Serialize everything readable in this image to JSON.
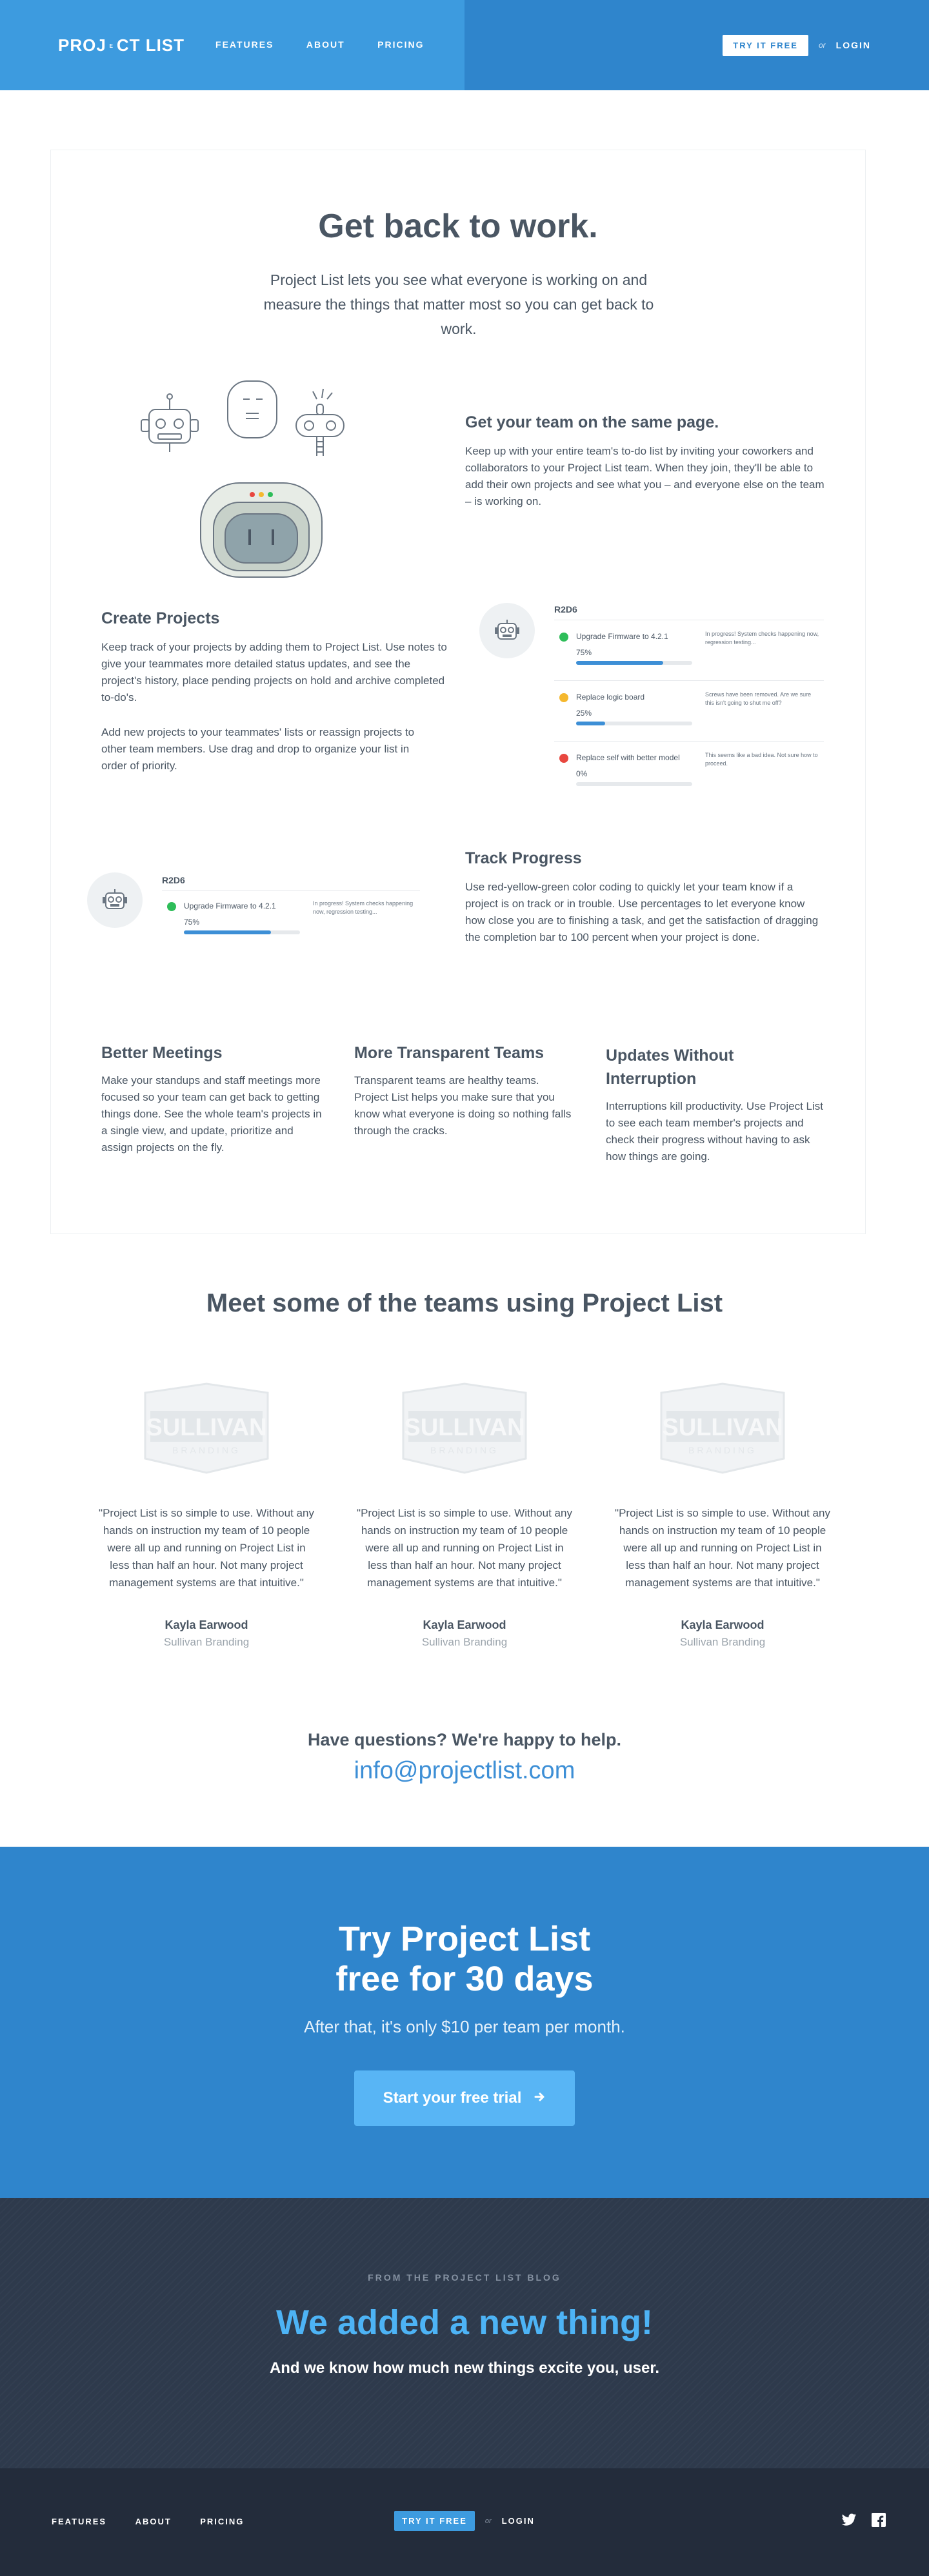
{
  "header": {
    "logo_pre": "PROJ",
    "logo_mid": "E",
    "logo_post": "CT LIST",
    "nav": [
      "FEATURES",
      "ABOUT",
      "PRICING"
    ],
    "try_label": "TRY IT FREE",
    "or_label": "or",
    "login_label": "LOGIN"
  },
  "hero": {
    "title": "Get back to work.",
    "subtitle": "Project List lets you see what everyone is working on and measure the things that matter most so you can get back to work."
  },
  "sections": {
    "team": {
      "title": "Get your team on the same page.",
      "text": "Keep up with your entire team's to-do list by inviting your coworkers and collaborators to your Project List team. When they join, they'll be able to add their own projects and see what you – and everyone else on the team – is working on."
    },
    "create": {
      "title": "Create Projects",
      "text1": "Keep track of your projects by adding them to Project List. Use notes to give your teammates more detailed status updates, and see the project's history, place pending projects on hold and archive completed to-do's.",
      "text2": "Add new projects to your teammates' lists or reassign projects to other team members. Use drag and drop to organize your list in order of priority."
    },
    "track": {
      "title": "Track Progress",
      "text": "Use red-yellow-green color coding to quickly let your team know if a project is on track or in trouble. Use percentages to let everyone know how close you are to finishing a task, and get the satisfaction of dragging the completion bar to 100 percent when your project is done."
    },
    "meetings": {
      "title": "Better Meetings",
      "text": "Make your standups and staff meetings more focused so your team can get back to getting things done. See the whole team's projects in a single view, and update, prioritize and assign projects on the fly."
    },
    "transparent": {
      "title": "More Transparent Teams",
      "text": "Transparent teams are healthy teams. Project List helps you make sure that you know what everyone is doing so nothing falls through the cracks."
    },
    "updates": {
      "title": "Updates Without Interruption",
      "text": "Interruptions kill productivity. Use Project List to see each team member's projects and check their progress without having to ask how things are going."
    }
  },
  "panel_main": {
    "name": "R2D6",
    "tasks": [
      {
        "label": "Upgrade Firmware to 4.2.1",
        "note": "In progress! System checks happening now, regression testing...",
        "pct_label": "75%",
        "progress": 0.75,
        "status_color": "#2ebd59"
      },
      {
        "label": "Replace logic board",
        "note": "Screws have been removed. Are we sure this isn't going to shut me off?",
        "pct_label": "25%",
        "progress": 0.25,
        "status_color": "#f5b82e"
      },
      {
        "label": "Replace self with better model",
        "note": "This seems like a bad idea. Not sure how to proceed.",
        "pct_label": "0%",
        "progress": 0,
        "status_color": "#e8473f"
      }
    ]
  },
  "panel_small": {
    "name": "R2D6",
    "task": {
      "label": "Upgrade Firmware to 4.2.1",
      "note": "In progress! System checks happening now, regression testing...",
      "pct_label": "75%",
      "progress": 0.75,
      "status_color": "#2ebd59"
    }
  },
  "teams": {
    "title": "Meet some of the teams using Project List",
    "logo_main": "SULLIVAN",
    "logo_sub": "BRANDING",
    "testimonials": [
      {
        "quote": "\"Project List is so simple to use. Without any hands on instruction my team of 10 people were all up and running on Project List in less than half an hour. Not many project management systems are that intuitive.\"",
        "name": "Kayla Earwood",
        "company": "Sullivan Branding"
      },
      {
        "quote": "\"Project List is so simple to use. Without any hands on instruction my team of 10 people were all up and running on Project List in less than half an hour. Not many project management systems are that intuitive.\"",
        "name": "Kayla Earwood",
        "company": "Sullivan Branding"
      },
      {
        "quote": "\"Project List is so simple to use. Without any hands on instruction my team of 10 people were all up and running on Project List in less than half an hour. Not many project management systems are that intuitive.\"",
        "name": "Kayla Earwood",
        "company": "Sullivan Branding"
      }
    ]
  },
  "contact": {
    "question": "Have questions? We're happy to help.",
    "email": "info@projectlist.com"
  },
  "cta": {
    "title_line1": "Try Project List",
    "title_line2": "free for 30 days",
    "subtitle": "After that, it's only $10 per team per month.",
    "button": "Start your free trial",
    "button_icon": "arrow-right-icon"
  },
  "blog": {
    "kicker": "FROM THE PROJECT LIST BLOG",
    "title": "We added a new thing!",
    "subtitle": "And we know how much new things excite you, user."
  },
  "footer": {
    "nav": [
      "FEATURES",
      "ABOUT",
      "PRICING"
    ],
    "try_label": "TRY IT FREE",
    "or_label": "or",
    "login_label": "LOGIN",
    "social": [
      "twitter-icon",
      "facebook-icon"
    ]
  },
  "colors": {
    "header_blue": "#3d9bdf",
    "header_dark_blue": "#2f85cc",
    "text": "#4a5663",
    "accent": "#3d8fd6",
    "blog_bg": "#2e3a4c",
    "footer_bg": "#232c3b"
  }
}
